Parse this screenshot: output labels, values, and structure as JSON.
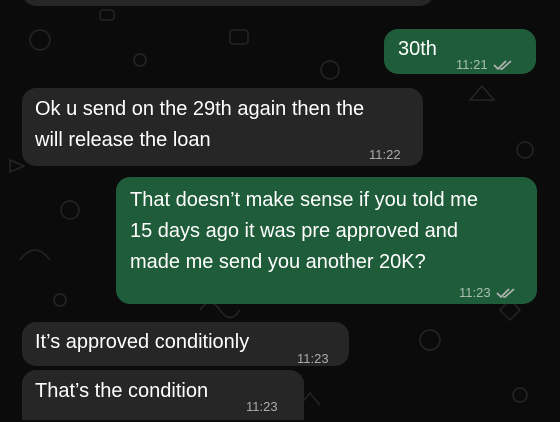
{
  "chat": {
    "messages": [
      {
        "direction": "outgoing",
        "text": "30th",
        "time": "11:21",
        "status": "read"
      },
      {
        "direction": "incoming",
        "text": "Ok u send on the 29th again then the\nwill release the loan",
        "time": "11:22"
      },
      {
        "direction": "outgoing",
        "text": "That doesn’t make sense if you told me\n15 days ago it was pre approved and\nmade me send you another 20K?",
        "time": "11:23",
        "status": "read"
      },
      {
        "direction": "incoming",
        "text": "It’s approved conditionly",
        "time": "11:23"
      },
      {
        "direction": "incoming",
        "text": "That’s the condition",
        "time": "11:23"
      }
    ]
  },
  "colors": {
    "background": "#0b0b0b",
    "incoming_bubble": "#262626",
    "outgoing_bubble": "#1f5c3a",
    "text": "#ffffff",
    "meta_text": "#9a9a9a"
  },
  "icons": {
    "read_receipt": "double-check-icon"
  }
}
